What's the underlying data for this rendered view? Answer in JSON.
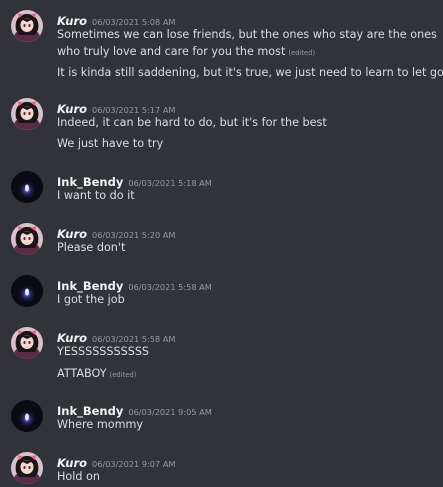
{
  "users": {
    "kuro": {
      "name": "Kuro",
      "avatar_icon": "kuro-anime-girl-avatar",
      "colors": {
        "bg": "#d6c2ca",
        "hair": "#1c1416",
        "face": "#f2d9cf",
        "ribbon": "#e55d8a",
        "outfit": "#5b2b45"
      }
    },
    "ink": {
      "name": "Ink_Bendy",
      "avatar_icon": "ink-bendy-glow-avatar",
      "colors": {
        "bg": "#0a0a12",
        "glow": "#b7a8ff",
        "accent": "#4a56d6"
      }
    }
  },
  "edited_label": "(edited)",
  "groups": [
    {
      "user": "kuro",
      "time": "06/03/2021 5:08 AM",
      "lines": [
        "Sometimes we can lose friends, but the ones who stay are the ones",
        "who truly love and care for you the most",
        "It is kinda still saddening, but it's true, we just need to learn to let go"
      ]
    },
    {
      "user": "kuro",
      "time": "06/03/2021 5:17 AM",
      "lines": [
        "Indeed, it can be hard to do, but it's for the best",
        "We just have to try"
      ]
    },
    {
      "user": "ink",
      "time": "06/03/2021 5:18 AM",
      "lines": [
        "I want to do it"
      ]
    },
    {
      "user": "kuro",
      "time": "06/03/2021 5:20 AM",
      "lines": [
        "Please don't"
      ]
    },
    {
      "user": "ink",
      "time": "06/03/2021 5:58 AM",
      "lines": [
        "I got the job"
      ]
    },
    {
      "user": "kuro",
      "time": "06/03/2021 5:58 AM",
      "lines": [
        "YESSSSSSSSSSS",
        "ATTABOY"
      ]
    },
    {
      "user": "ink",
      "time": "06/03/2021 9:05 AM",
      "lines": [
        "Where mommy"
      ]
    },
    {
      "user": "kuro",
      "time": "06/03/2021 9:07 AM",
      "lines": [
        "Hold on"
      ]
    }
  ]
}
